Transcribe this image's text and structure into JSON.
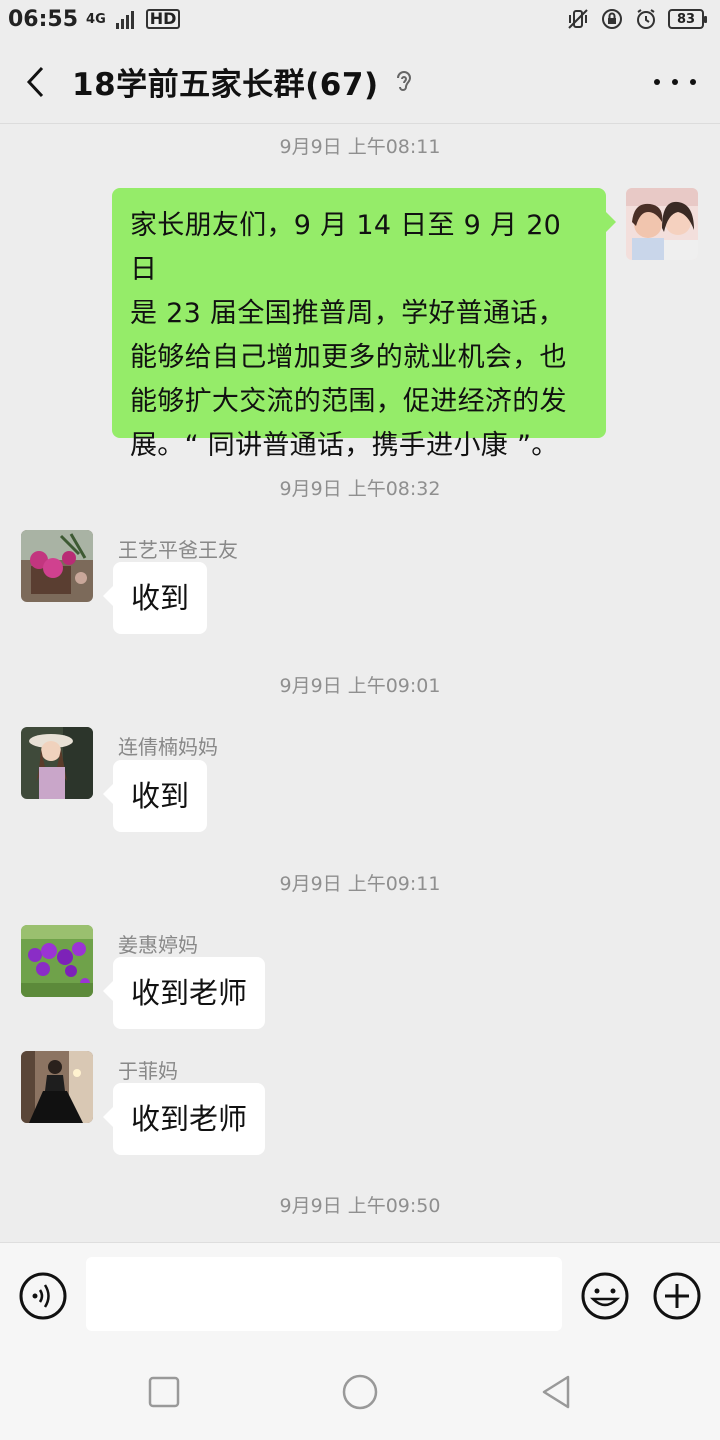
{
  "status_bar": {
    "time": "06:55",
    "network": "4G",
    "hd": "HD",
    "battery": "83",
    "icons": [
      "mute-vibrate-icon",
      "rotation-lock-icon",
      "alarm-icon",
      "battery-icon"
    ]
  },
  "header": {
    "title": "18学前五家长群(67)",
    "back_icon": "chevron-left-icon",
    "ear_icon": "earpiece-icon",
    "more_icon": "more-dots-icon"
  },
  "messages": [
    {
      "type": "time",
      "text": "9月9日 上午08:11"
    },
    {
      "type": "sent",
      "lines": [
        "家长朋友们，9 月 14 日至 9 月 20 日",
        "是 23 届全国推普周，学好普通话，",
        "能够给自己增加更多的就业机会，也",
        "能够扩大交流的范围，促进经济的发",
        "展。“ 同讲普通话，携手进小康 ”。"
      ]
    },
    {
      "type": "time",
      "text": "9月9日 上午08:32"
    },
    {
      "type": "received",
      "sender": "王艺平爸王友",
      "text": "收到"
    },
    {
      "type": "time",
      "text": "9月9日 上午09:01"
    },
    {
      "type": "received",
      "sender": "连倩楠妈妈",
      "text": "收到"
    },
    {
      "type": "time",
      "text": "9月9日 上午09:11"
    },
    {
      "type": "received",
      "sender": "姜惠婷妈",
      "text": "收到老师"
    },
    {
      "type": "received",
      "sender": "于菲妈",
      "text": "收到老师"
    },
    {
      "type": "time",
      "text": "9月9日 上午09:50"
    }
  ],
  "input_bar": {
    "value": "",
    "icons": [
      "voice-icon",
      "emoji-icon",
      "plus-icon"
    ]
  },
  "nav_bar": {
    "icons": [
      "recent-apps-icon",
      "home-icon",
      "back-icon"
    ]
  },
  "colors": {
    "background": "#ededed",
    "sent_bubble": "#95ec69",
    "received_bubble": "#ffffff",
    "timestamp": "#8f8f8f"
  }
}
